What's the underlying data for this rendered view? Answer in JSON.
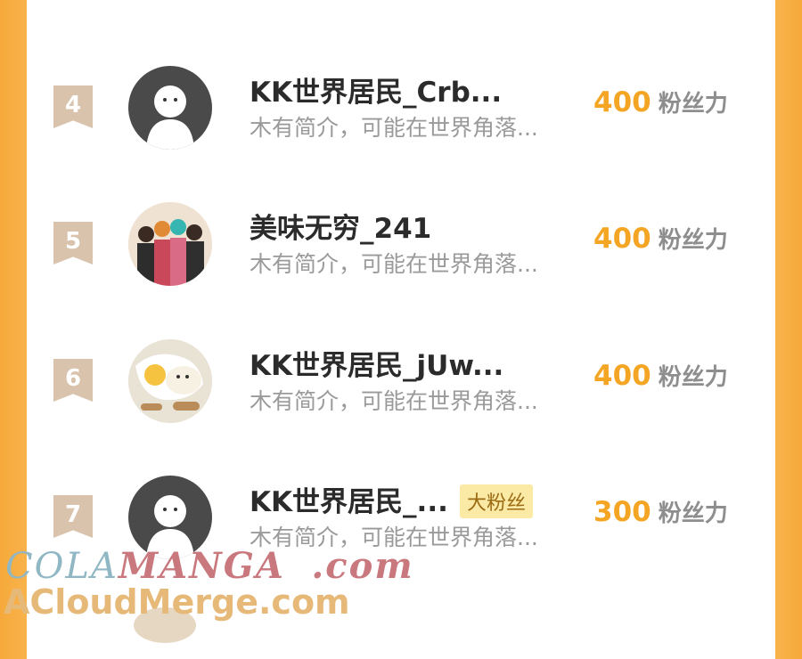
{
  "rows": [
    {
      "rank": "4",
      "name": "KK世界居民_Crb...",
      "bio": "木有简介，可能在世界角落...",
      "score": "400",
      "unit": "粉丝力",
      "avatar": "default",
      "badge": ""
    },
    {
      "rank": "5",
      "name": "美味无穷_241",
      "bio": "木有简介，可能在世界角落...",
      "score": "400",
      "unit": "粉丝力",
      "avatar": "photo",
      "badge": ""
    },
    {
      "rank": "6",
      "name": "KK世界居民_jUw...",
      "bio": "木有简介，可能在世界角落...",
      "score": "400",
      "unit": "粉丝力",
      "avatar": "cat",
      "badge": ""
    },
    {
      "rank": "7",
      "name": "KK世界居民_...",
      "bio": "木有简介，可能在世界角落...",
      "score": "300",
      "unit": "粉丝力",
      "avatar": "default",
      "badge": "大粉丝"
    }
  ],
  "watermark": {
    "line1_a": "COLA",
    "line1_b": "MANGA",
    "line1_c": ".com",
    "line2": "ACloudMerge.com"
  },
  "colors": {
    "accent": "#f5a524",
    "background": "#f8b24a",
    "rank_badge": "#d9c3ad"
  }
}
